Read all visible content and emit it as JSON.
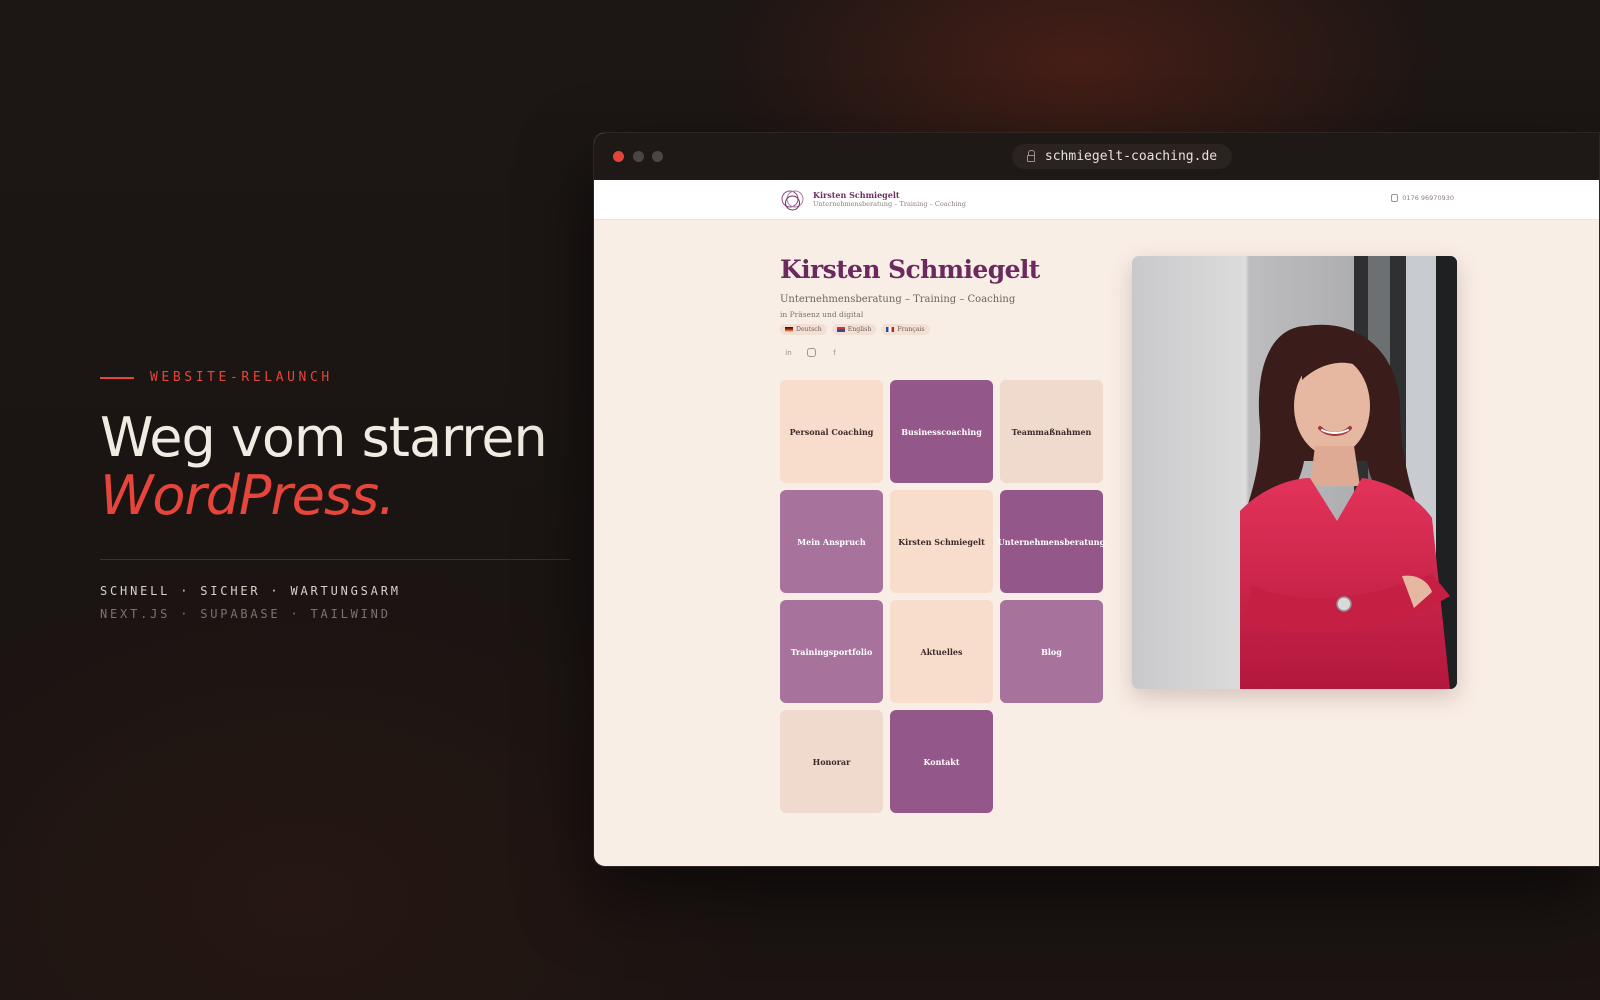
{
  "hero": {
    "eyebrow": "WEBSITE-RELAUNCH",
    "headline_line1": "Weg vom starren",
    "headline_line2": "WordPress.",
    "tags_primary": "SCHNELL · SICHER · WARTUNGSARM",
    "tags_secondary": "NEXT.JS · SUPABASE · TAILWIND"
  },
  "browser": {
    "url": "schmiegelt-coaching.de"
  },
  "site": {
    "header": {
      "name": "Kirsten Schmiegelt",
      "tagline": "Unternehmensberatung – Training – Coaching",
      "phone": "0176 96970930"
    },
    "title": "Kirsten Schmiegelt",
    "subtitle": "Unternehmensberatung – Training – Coaching",
    "subnote": "in Präsenz und digital",
    "languages": [
      {
        "label": "Deutsch",
        "flag": "de-flag-icon"
      },
      {
        "label": "English",
        "flag": "uk-flag-icon"
      },
      {
        "label": "Français",
        "flag": "fr-flag-icon"
      }
    ],
    "socials": [
      "linkedin-icon",
      "instagram-icon",
      "facebook-icon"
    ],
    "tiles": [
      {
        "label": "Personal Coaching",
        "color": "#f8ddcc"
      },
      {
        "label": "Businesscoaching",
        "color": "#94578a"
      },
      {
        "label": "Teammaßnahmen",
        "color": "#efdacd"
      },
      {
        "label": "Mein Anspruch",
        "color": "#a7739d"
      },
      {
        "label": "Kirsten Schmiegelt",
        "color": "#f8ddcc"
      },
      {
        "label": "Unternehmensberatung",
        "color": "#94578a"
      },
      {
        "label": "Trainingsportfolio",
        "color": "#a7739d"
      },
      {
        "label": "Aktuelles",
        "color": "#f8ddcc"
      },
      {
        "label": "Blog",
        "color": "#a7739d"
      },
      {
        "label": "Honorar",
        "color": "#efdacd"
      },
      {
        "label": "Kontakt",
        "color": "#94578a"
      }
    ]
  },
  "colors": {
    "accent": "#e5453a",
    "brand_purple": "#6b2a5e",
    "page_bg": "#f9eee6"
  }
}
